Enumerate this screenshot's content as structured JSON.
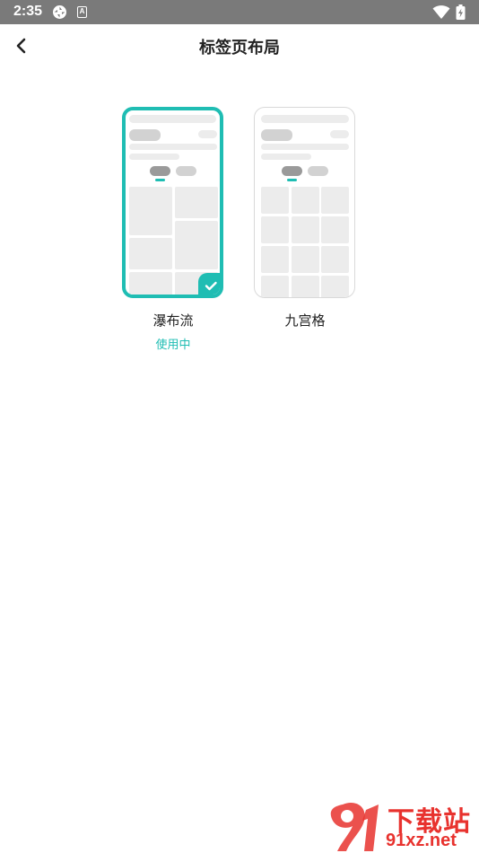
{
  "status_bar": {
    "time": "2:35",
    "badge_letter": "A"
  },
  "header": {
    "title": "标签页布局"
  },
  "options": [
    {
      "label": "瀑布流",
      "status": "使用中",
      "selected": true
    },
    {
      "label": "九宫格",
      "status": "",
      "selected": false
    }
  ],
  "watermark": {
    "text": "下载站",
    "url": "91xz.net"
  },
  "colors": {
    "accent": "#1fbdb3",
    "status_bar": "#7a7a7a",
    "watermark": "#e8322e"
  }
}
